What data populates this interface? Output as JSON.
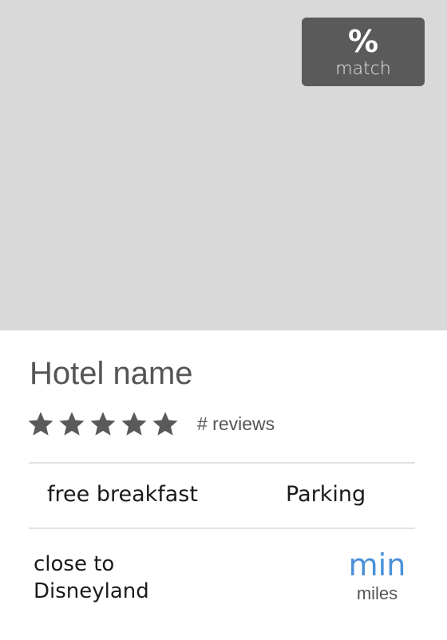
{
  "hotel_card": {
    "photo": {
      "placeholder_color": "#d9d9d9"
    },
    "match_badge": {
      "value": "%",
      "label": "match",
      "background_color": "#5a5a5a"
    },
    "name": "Hotel name",
    "rating": {
      "stars_filled": 5,
      "stars_total": 5,
      "star_color": "#5a5a5a",
      "reviews_label": "# reviews"
    },
    "amenities": [
      "free breakfast",
      "Parking"
    ],
    "location": {
      "line1": "close to",
      "line2": "Disneyland"
    },
    "distance": {
      "time_label": "min",
      "distance_label": "miles",
      "accent_color": "#4a90d9"
    }
  }
}
